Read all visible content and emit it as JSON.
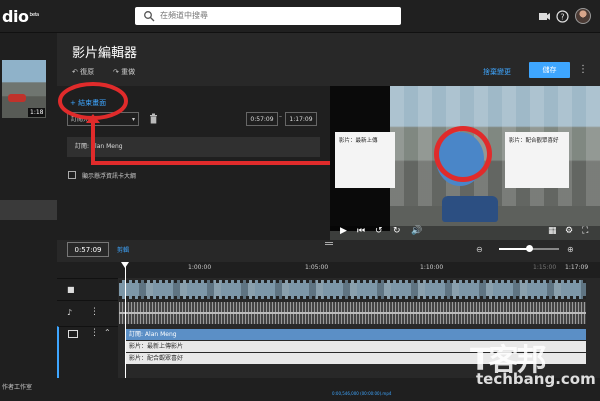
{
  "app": {
    "logo_text": "dio",
    "logo_suffix": "beta",
    "studio_label": "作者工作室"
  },
  "search": {
    "placeholder": "在頻道中搜尋"
  },
  "header_icons": [
    "camera-icon",
    "help-icon",
    "avatar"
  ],
  "page": {
    "title": "影片編輯器"
  },
  "toolbar": {
    "undo_label": "復原",
    "redo_label": "重做",
    "discard_label": "捨棄變更",
    "save_label": "儲存"
  },
  "sidebar": {
    "thumbnail_duration": "1:18"
  },
  "editor": {
    "add_screen_label": "+ 結束畫面",
    "dropdown_value": "訂閱元素",
    "start_time": "0:57:09",
    "end_time": "1:17:09",
    "time_separator": "–",
    "item_label": "訂閱: Alan Meng",
    "checkbox_label": "顯示懸浮資訊卡大綱"
  },
  "preview": {
    "card_left_label": "影片：最新上傳",
    "card_right_label": "影片：配合觀眾喜好"
  },
  "timeline": {
    "current_time": "0:57:09",
    "cut_label": "剪輯",
    "ticks": [
      "1:00:00",
      "1:05:00",
      "1:10:00",
      "1:15:00",
      "1:17:09"
    ],
    "lanes": [
      "訂閱: Alan Meng",
      "影片：最新上傳影片",
      "影片：配合觀眾喜好"
    ],
    "zoom_fraction": 0.5,
    "footer_note": "0:00,546,000 (00:00:00).mp4"
  },
  "watermark": {
    "main": "T客邦",
    "sub": "techbang.com"
  },
  "colors": {
    "accent": "#3ea6ff",
    "annotation": "#e02b2b",
    "background": "#282828"
  }
}
